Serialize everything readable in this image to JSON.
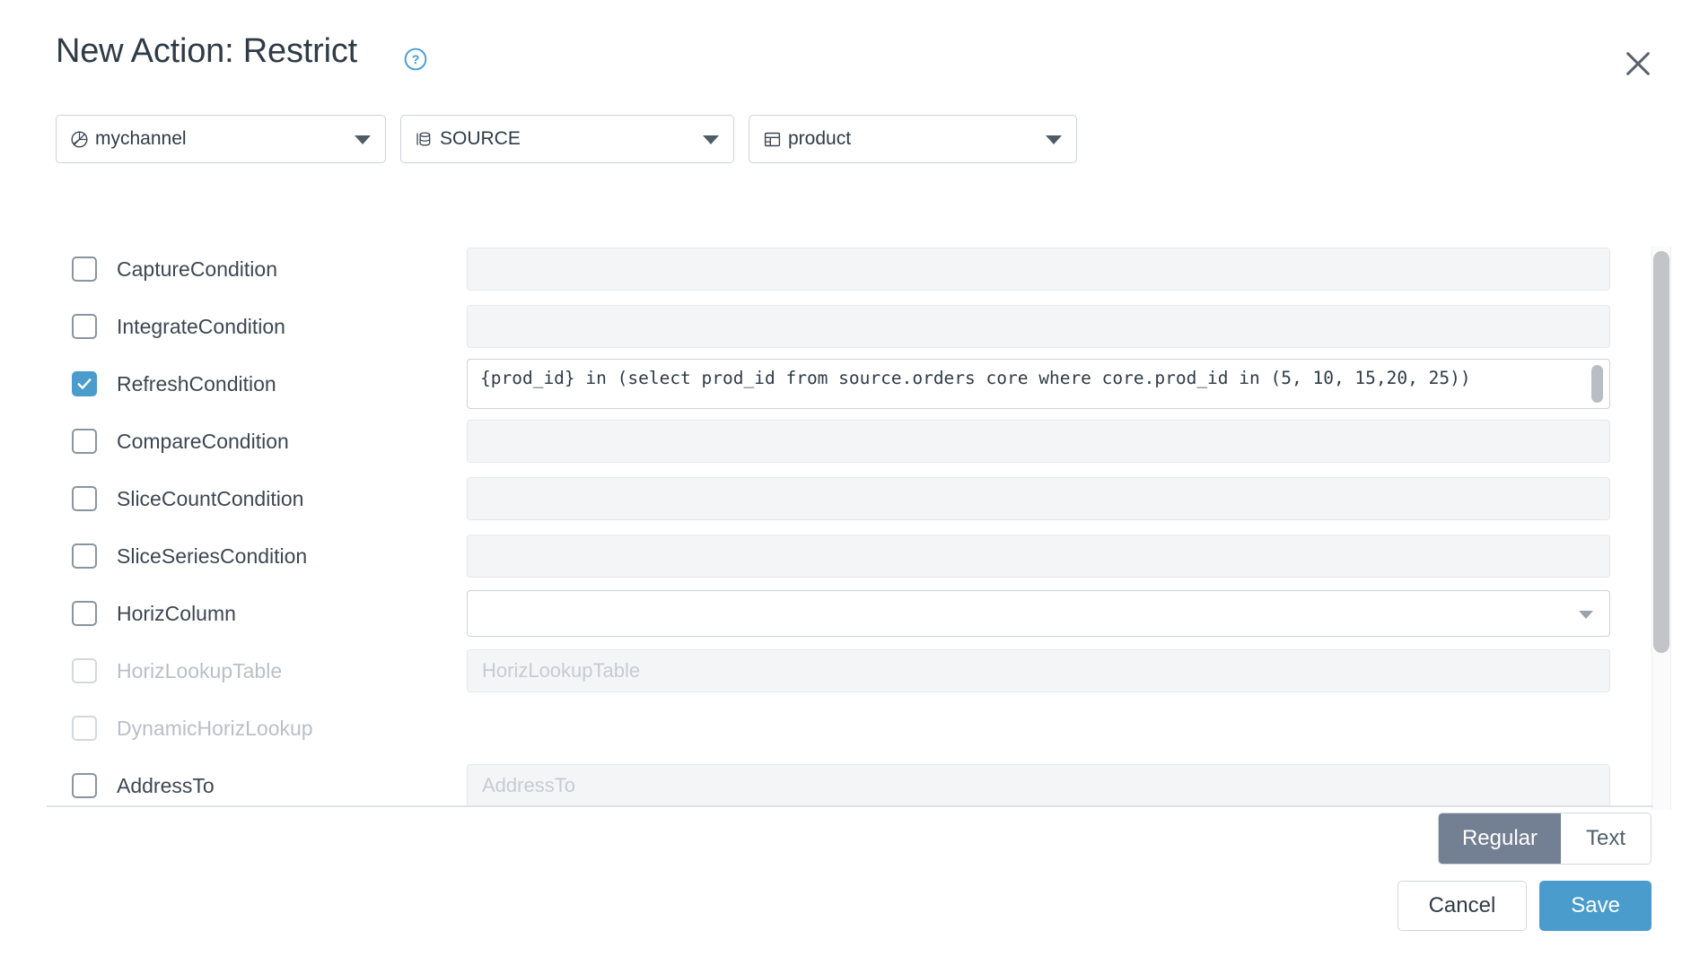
{
  "dialog": {
    "title": "New Action: Restrict",
    "help_icon": "help-circle-icon",
    "close_icon": "close-icon"
  },
  "selectors": [
    {
      "icon": "channel-icon",
      "label": "mychannel"
    },
    {
      "icon": "database-icon",
      "label": "SOURCE"
    },
    {
      "icon": "table-icon",
      "label": "product"
    }
  ],
  "rows": [
    {
      "label": "CaptureCondition",
      "checked": false,
      "disabled": false,
      "field": "blank",
      "value": "",
      "placeholder": ""
    },
    {
      "label": "IntegrateCondition",
      "checked": false,
      "disabled": false,
      "field": "blank",
      "value": "",
      "placeholder": ""
    },
    {
      "label": "RefreshCondition",
      "checked": true,
      "disabled": false,
      "field": "textarea",
      "value": "{prod_id} in (select prod_id from source.orders core where core.prod_id in (5, 10, 15,20, 25))",
      "placeholder": ""
    },
    {
      "label": "CompareCondition",
      "checked": false,
      "disabled": false,
      "field": "blank",
      "value": "",
      "placeholder": ""
    },
    {
      "label": "SliceCountCondition",
      "checked": false,
      "disabled": false,
      "field": "blank",
      "value": "",
      "placeholder": ""
    },
    {
      "label": "SliceSeriesCondition",
      "checked": false,
      "disabled": false,
      "field": "blank",
      "value": "",
      "placeholder": ""
    },
    {
      "label": "HorizColumn",
      "checked": false,
      "disabled": false,
      "field": "dropdown",
      "value": "",
      "placeholder": ""
    },
    {
      "label": "HorizLookupTable",
      "checked": false,
      "disabled": true,
      "field": "blank",
      "value": "",
      "placeholder": "HorizLookupTable"
    },
    {
      "label": "DynamicHorizLookup",
      "checked": false,
      "disabled": true,
      "field": "none",
      "value": "",
      "placeholder": ""
    },
    {
      "label": "AddressTo",
      "checked": false,
      "disabled": false,
      "field": "blank",
      "value": "",
      "placeholder": "AddressTo"
    }
  ],
  "footer": {
    "toggle": {
      "options": [
        "Regular",
        "Text"
      ],
      "selected": "Regular"
    },
    "cancel_label": "Cancel",
    "save_label": "Save"
  },
  "colors": {
    "accent": "#4a9ccd",
    "toggle_active": "#737f92",
    "field_bg": "#f4f5f7",
    "text": "#2f3b46"
  }
}
